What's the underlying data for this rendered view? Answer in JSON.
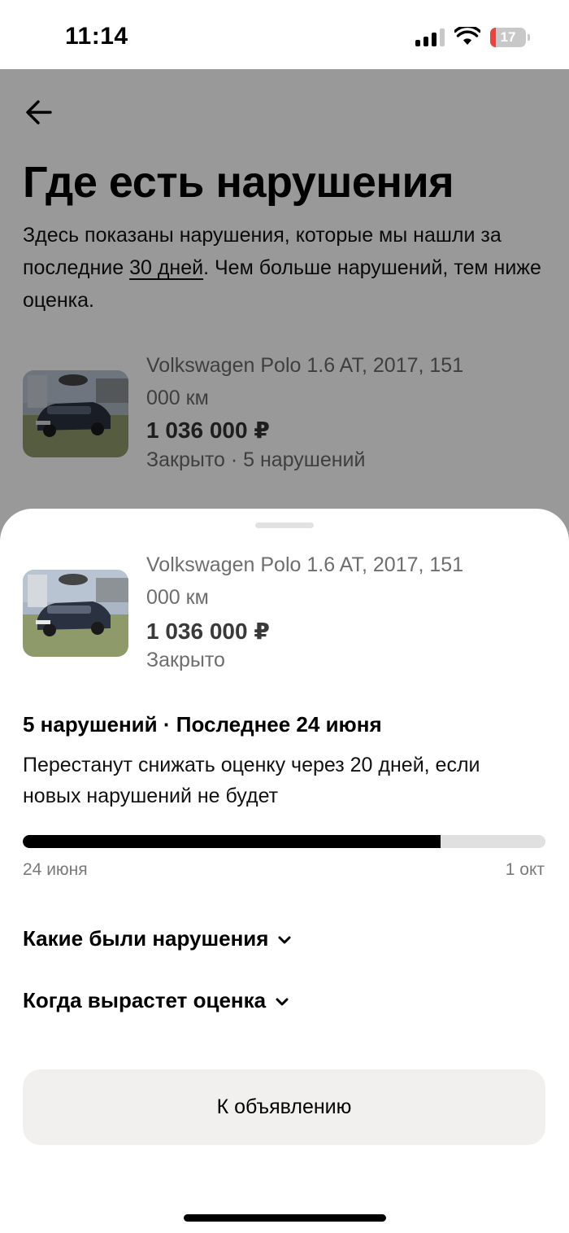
{
  "status_bar": {
    "time": "11:14",
    "battery_level": "17",
    "battery_fraction": 0.17,
    "icons": [
      "signal-icon",
      "wifi-icon",
      "battery-icon"
    ]
  },
  "page": {
    "back_icon": "arrow-left-icon",
    "title": "Где есть нарушения",
    "description_part1": "Здесь показаны нарушения, которые мы нашли за последние ",
    "description_link": "30 дней",
    "description_part2": ". Чем больше нарушений, тем ниже оценка.",
    "listing": {
      "title": "Volkswagen Polo 1.6 AT, 2017, 151 000 км",
      "price": "1 036 000 ₽",
      "status": "Закрыто · 5 нарушений"
    }
  },
  "sheet": {
    "listing": {
      "title": "Volkswagen Polo 1.6 AT, 2017, 151 000 км",
      "price": "1 036 000 ₽",
      "status": "Закрыто"
    },
    "summary_heading": "5 нарушений · Последнее 24 июня",
    "summary_note": "Перестанут снижать оценку через 20 дней, если новых нарушений не будет",
    "progress": {
      "fraction": 0.8,
      "start_label": "24 июня",
      "end_label": "1 окт"
    },
    "expanders": [
      {
        "label": "Какие были нарушения",
        "icon": "chevron-down-icon"
      },
      {
        "label": "Когда вырастет оценка",
        "icon": "chevron-down-icon"
      }
    ],
    "primary_button": "К объявлению"
  },
  "colors": {
    "overlay": "#000000",
    "button_bg": "#f1f0ee",
    "battery_low": "#f0403a",
    "progress_track": "#e0e0e0"
  }
}
